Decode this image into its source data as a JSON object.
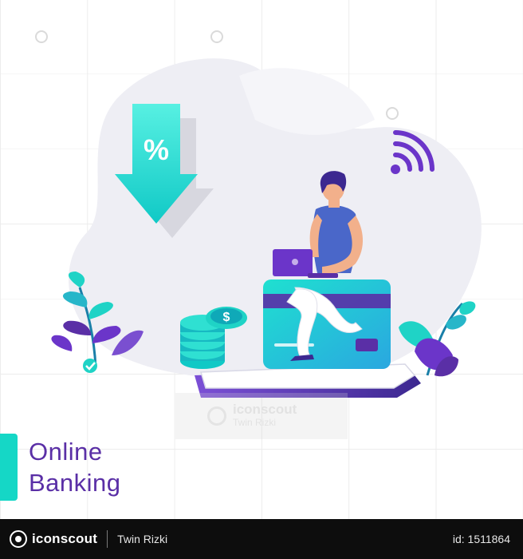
{
  "illustration": {
    "title_line1": "Online",
    "title_line2": "Banking",
    "badge_symbol": "%",
    "coin_symbol": "$",
    "icons": [
      "download-arrow-icon",
      "wifi-icon",
      "laptop-icon",
      "credit-card-icon",
      "coin-stack-icon",
      "plant-icon",
      "checkmark-icon"
    ],
    "colors": {
      "accent_cyan": "#15d7c6",
      "accent_purple": "#5a2fa6",
      "blob_gray": "#eeeef4"
    }
  },
  "watermark": {
    "brand": "iconscout",
    "author": "Twin Rizki"
  },
  "footer": {
    "brand": "iconscout",
    "author": "Twin Rizki",
    "asset_id": "id: 1511864"
  }
}
